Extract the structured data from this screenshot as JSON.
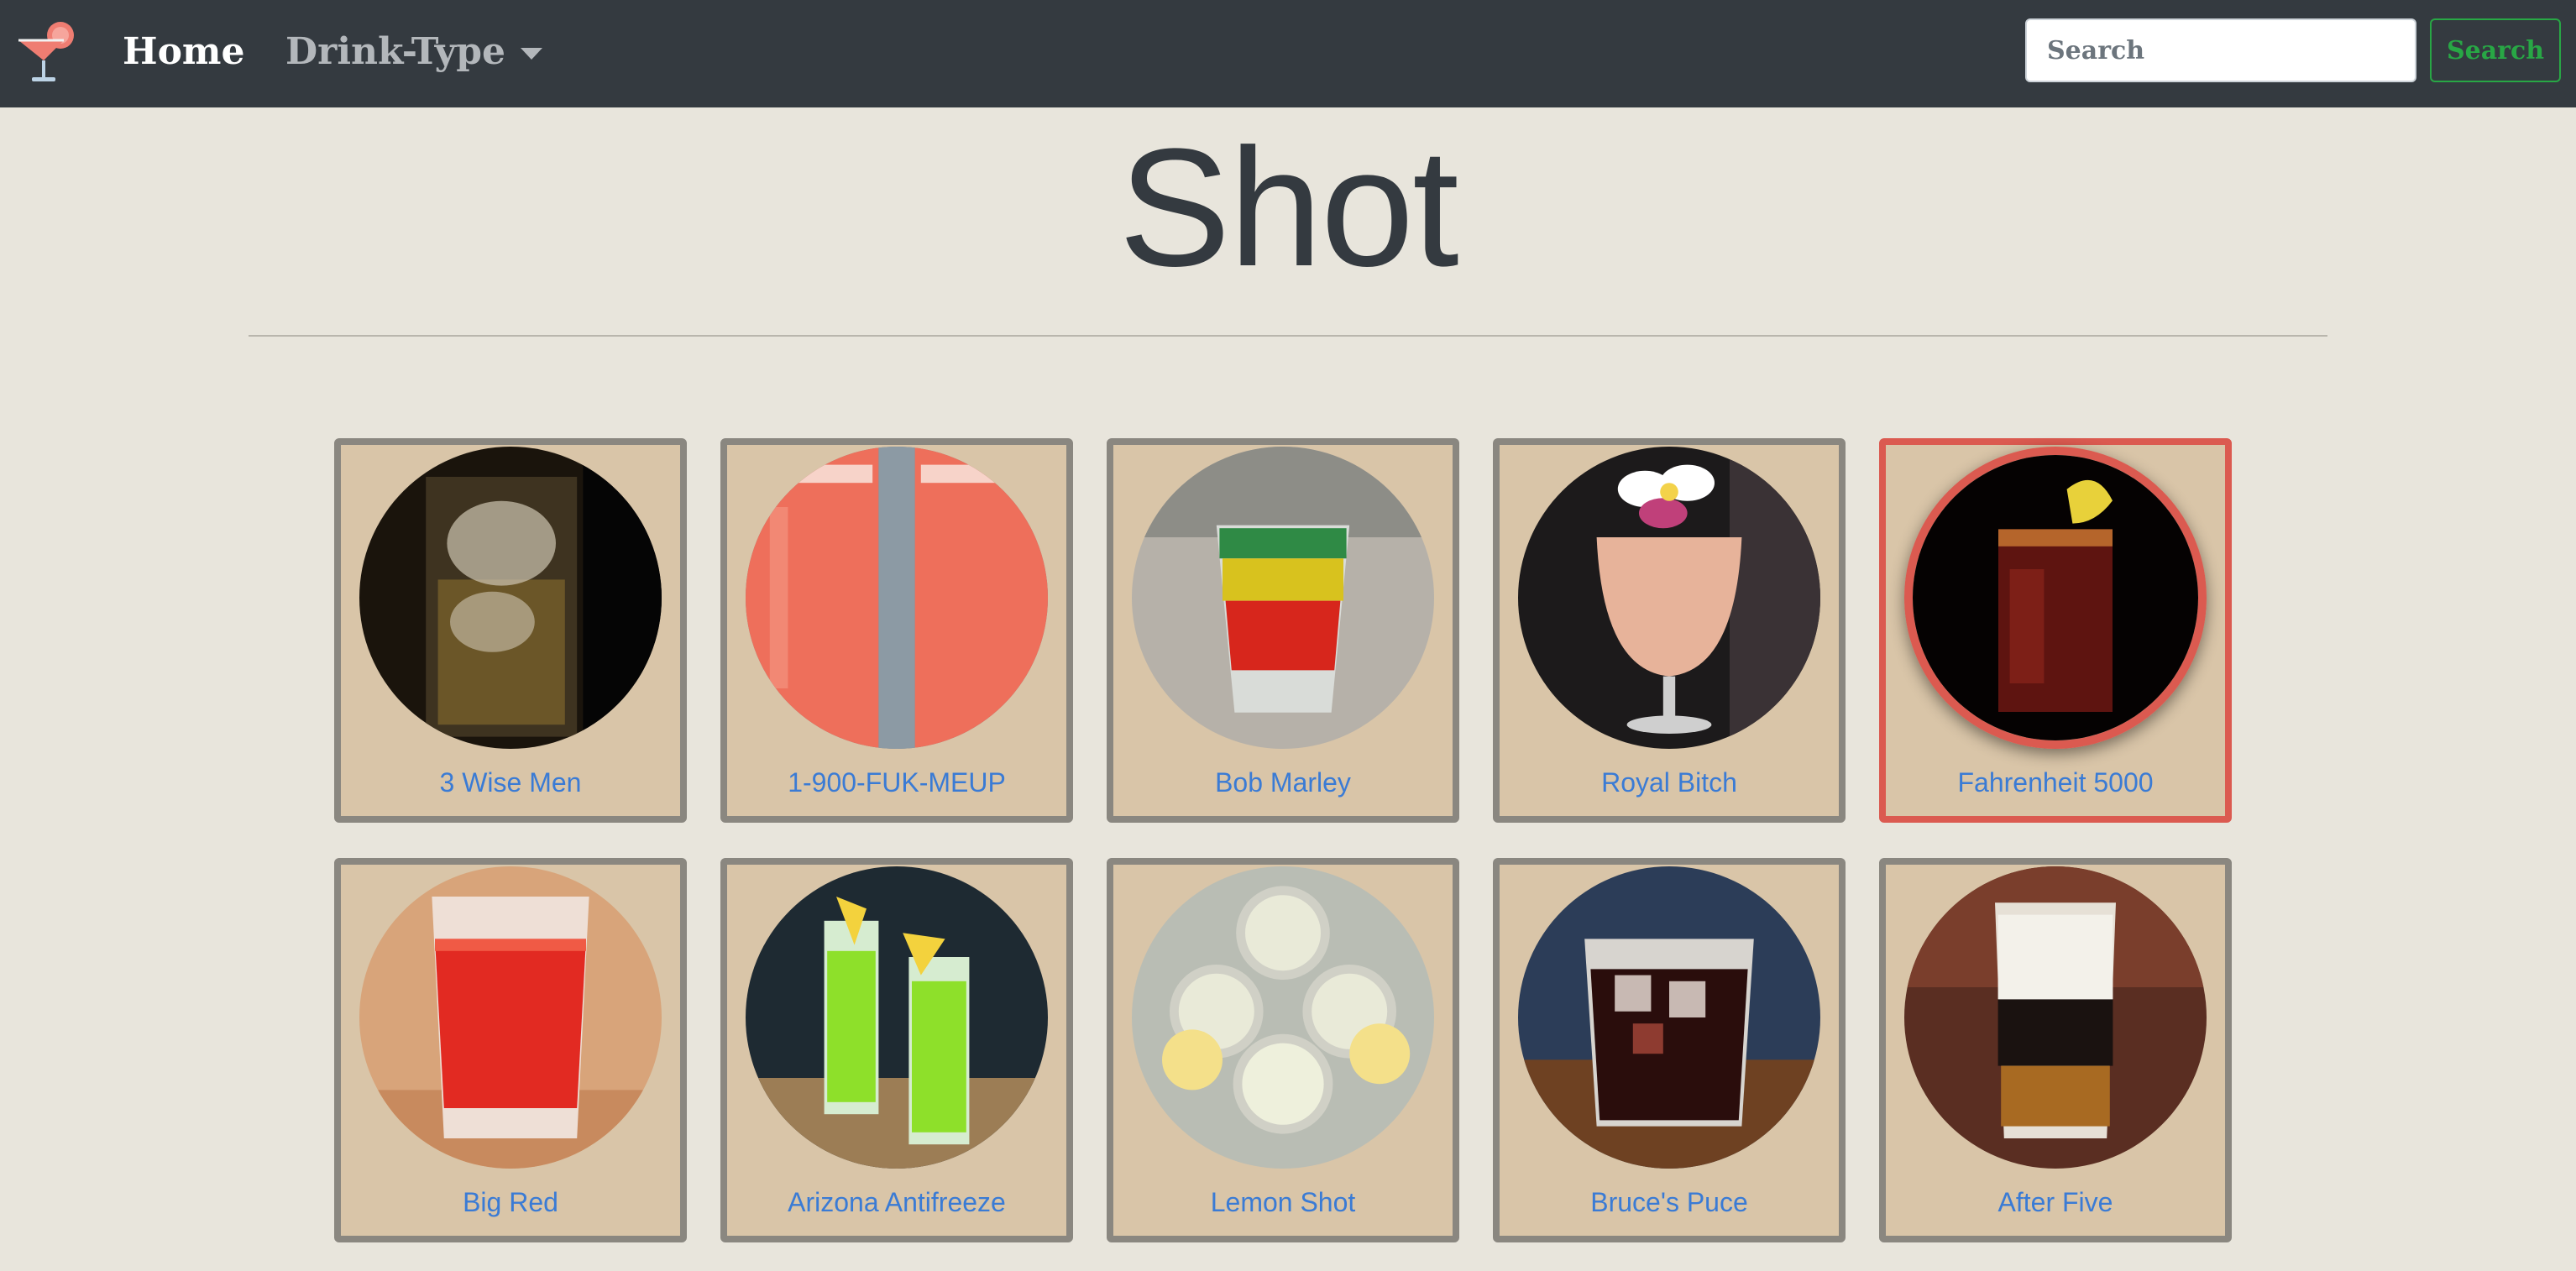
{
  "navbar": {
    "home_label": "Home",
    "drink_type_label": "Drink-Type",
    "search_placeholder": "Search",
    "search_value": "",
    "search_button_label": "Search",
    "brand_icon": "cocktail-glass-icon"
  },
  "page": {
    "title": "Shot"
  },
  "colors": {
    "navbar_bg": "#343a40",
    "page_bg": "#e8e5dc",
    "card_bg": "#d9c5a8",
    "card_border": "#8a8780",
    "selected_border": "#db5a50",
    "link": "#3a7bd5",
    "search_button": "#28a745"
  },
  "drinks": [
    {
      "name": "3 Wise Men",
      "selected": false
    },
    {
      "name": "1-900-FUK-MEUP",
      "selected": false
    },
    {
      "name": "Bob Marley",
      "selected": false
    },
    {
      "name": "Royal Bitch",
      "selected": false
    },
    {
      "name": "Fahrenheit 5000",
      "selected": true
    },
    {
      "name": "Big Red",
      "selected": false
    },
    {
      "name": "Arizona Antifreeze",
      "selected": false
    },
    {
      "name": "Lemon Shot",
      "selected": false
    },
    {
      "name": "Bruce's Puce",
      "selected": false
    },
    {
      "name": "After Five",
      "selected": false
    }
  ]
}
